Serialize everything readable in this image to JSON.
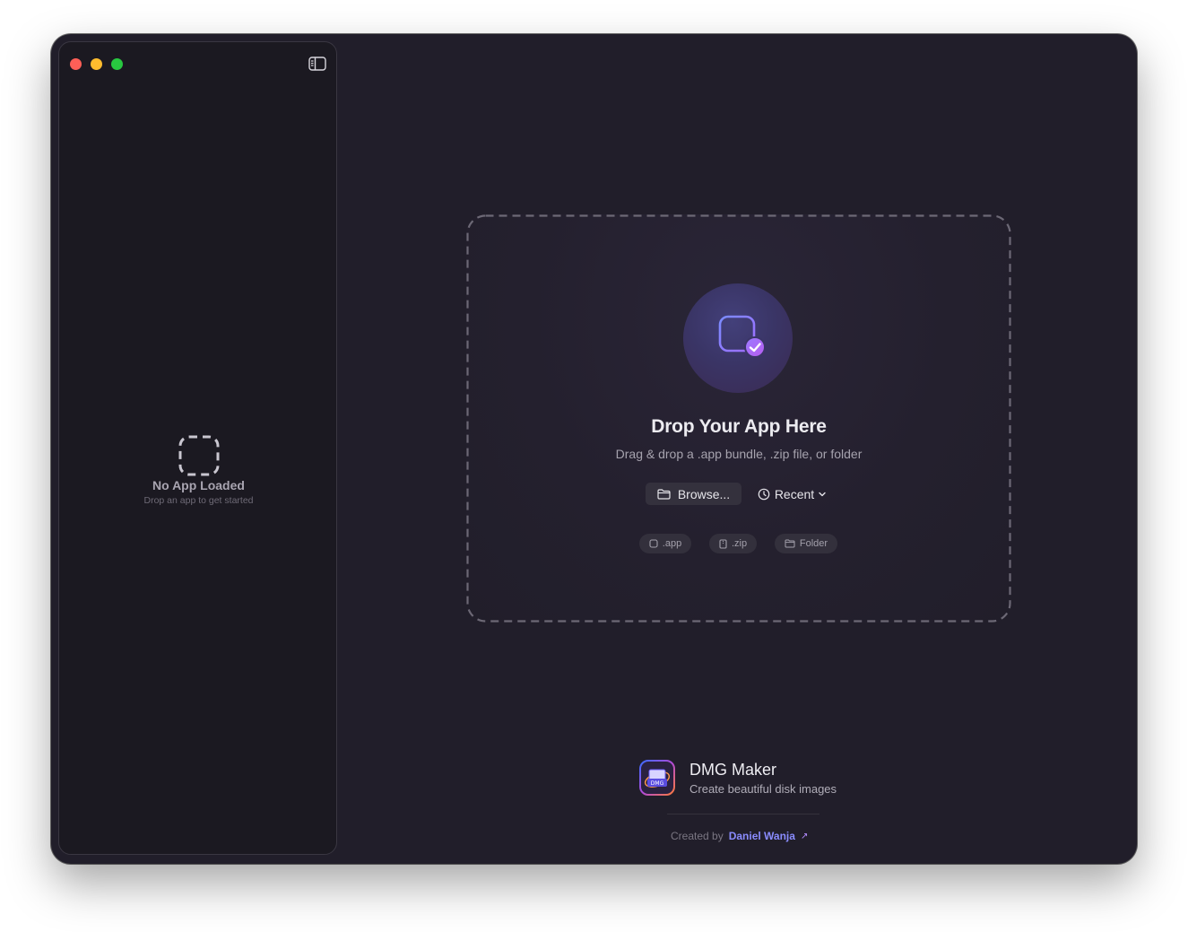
{
  "sidebar": {
    "empty_title": "No App Loaded",
    "empty_subtitle": "Drop an app to get started"
  },
  "dropzone": {
    "title": "Drop Your App Here",
    "subtitle": "Drag & drop a .app bundle, .zip file, or folder",
    "browse_label": "Browse...",
    "recent_label": "Recent",
    "chips": [
      {
        "label": ".app",
        "icon": "app-icon"
      },
      {
        "label": ".zip",
        "icon": "zip-icon"
      },
      {
        "label": "Folder",
        "icon": "folder-icon"
      }
    ]
  },
  "footer": {
    "app_name": "DMG Maker",
    "tagline": "Create beautiful disk images",
    "created_by_prefix": "Created by",
    "author": "Daniel Wanja",
    "link_arrow": "↗"
  },
  "colors": {
    "window_bg": "#211e2a",
    "sidebar_bg": "#1b1921",
    "accent": "#8a8cff",
    "accent_purple": "#9b6dff",
    "traffic_red": "#ff5f57",
    "traffic_yellow": "#febc2e",
    "traffic_green": "#28c840"
  }
}
